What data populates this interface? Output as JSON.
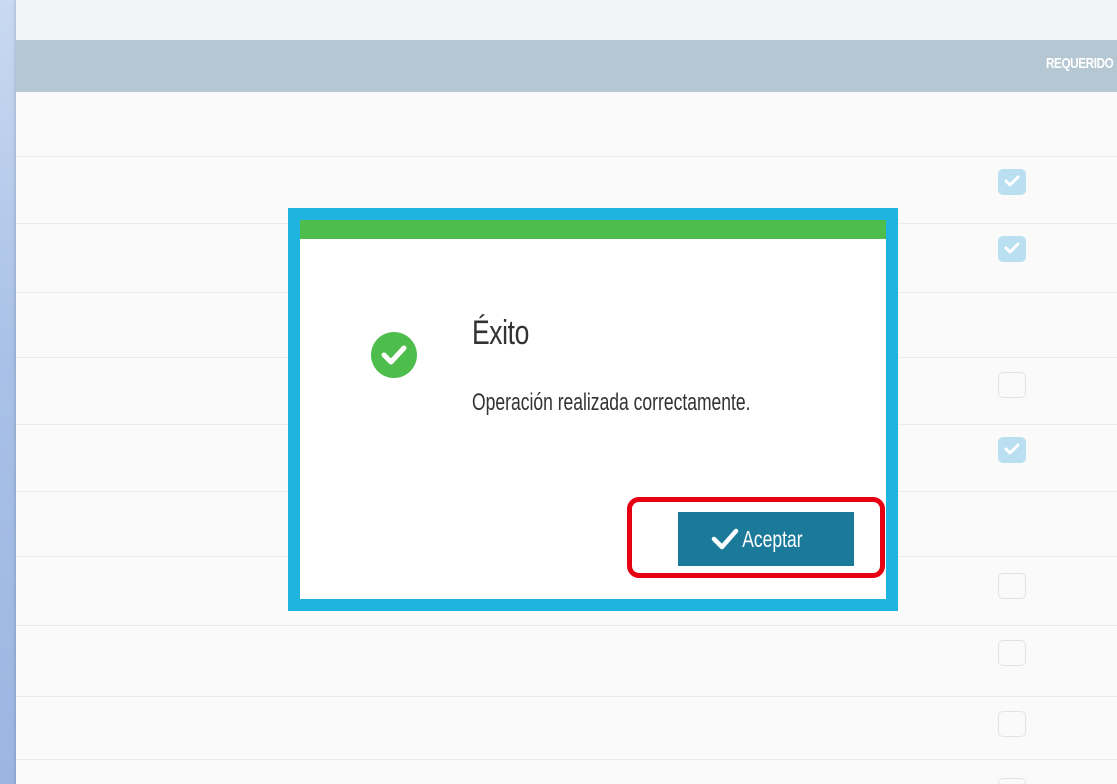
{
  "table": {
    "column_header": "REQUERIDO",
    "rows": [
      {
        "requerido": null
      },
      {
        "requerido": true
      },
      {
        "requerido": true
      },
      {
        "requerido": null
      },
      {
        "requerido": false
      },
      {
        "requerido": true
      },
      {
        "requerido": null
      },
      {
        "requerido": false
      },
      {
        "requerido": false
      },
      {
        "requerido": false
      },
      {
        "requerido": false
      }
    ]
  },
  "dialog": {
    "title": "Éxito",
    "message": "Operación realizada correctamente.",
    "accept_label": "Aceptar",
    "icon": "check-circle-icon",
    "status": "success"
  },
  "colors": {
    "dialog_border": "#1fb3df",
    "success_green": "#4dbd4b",
    "accept_button": "#1b7a9a",
    "table_header": "#b4c7d3",
    "highlight": "#e60012"
  }
}
